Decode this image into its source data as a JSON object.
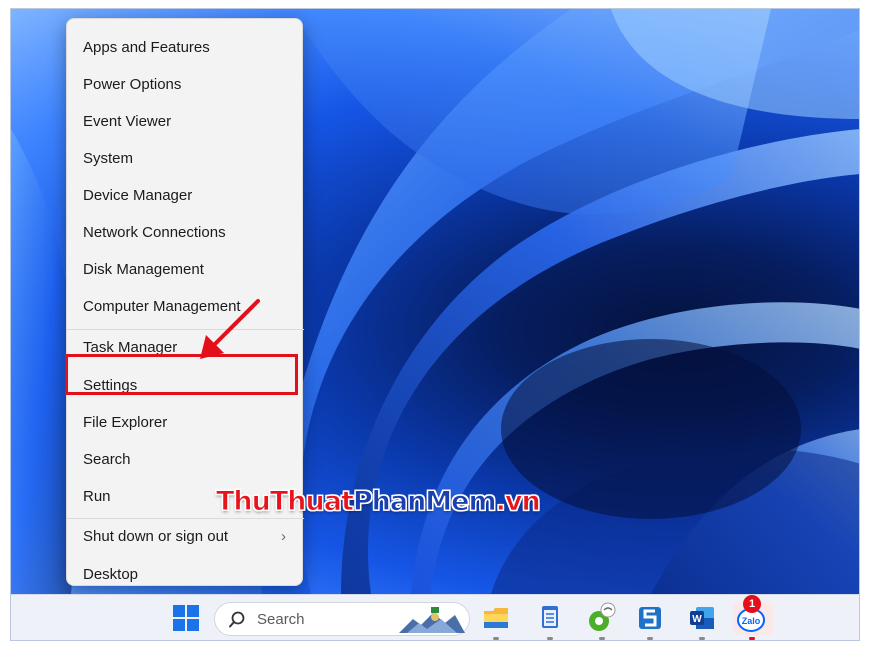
{
  "context_menu": {
    "items": [
      {
        "label": "Apps and Features"
      },
      {
        "label": "Power Options"
      },
      {
        "label": "Event Viewer"
      },
      {
        "label": "System"
      },
      {
        "label": "Device Manager"
      },
      {
        "label": "Network Connections"
      },
      {
        "label": "Disk Management"
      },
      {
        "label": "Computer Management"
      },
      {
        "label": "Task Manager"
      },
      {
        "label": "Settings"
      },
      {
        "label": "File Explorer"
      },
      {
        "label": "Search"
      },
      {
        "label": "Run"
      },
      {
        "label": "Shut down or sign out"
      },
      {
        "label": "Desktop"
      }
    ],
    "submenu_indicator": "›",
    "highlighted_item": "Settings"
  },
  "watermark": {
    "part1": "ThuThuat",
    "part2": "PhanMem",
    "part3": ".vn"
  },
  "taskbar": {
    "search_placeholder": "Search",
    "icons": [
      "windows-start-icon",
      "search-icon",
      "file-explorer-icon",
      "notepad-icon",
      "greenshot-icon",
      "snagit-icon",
      "word-icon",
      "zalo-icon"
    ],
    "zalo_label": "Zalo",
    "notification_count": "1"
  },
  "colors": {
    "highlight": "#e3101c",
    "menu_bg": "#f3f3f3",
    "taskbar_bg": "#eef2f8",
    "wallpaper_primary": "#1656e6"
  }
}
